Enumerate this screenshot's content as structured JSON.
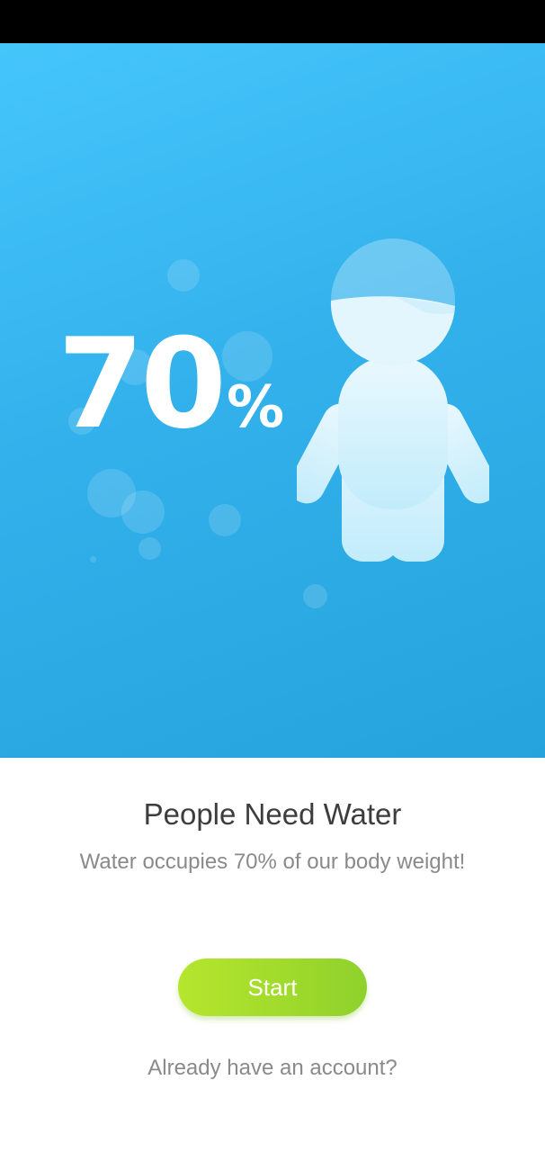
{
  "hero": {
    "percent_value": "70",
    "percent_unit": "%",
    "icon": "water-person-icon"
  },
  "content": {
    "title": "People Need Water",
    "subtitle": "Water occupies 70% of our body weight!",
    "start_label": "Start",
    "account_link": "Already have an account?"
  },
  "colors": {
    "hero_blue": "#33b1ec",
    "button_green": "#a4dc2c",
    "title_text": "#3d3d3d",
    "secondary_text": "#8a8a8a"
  }
}
